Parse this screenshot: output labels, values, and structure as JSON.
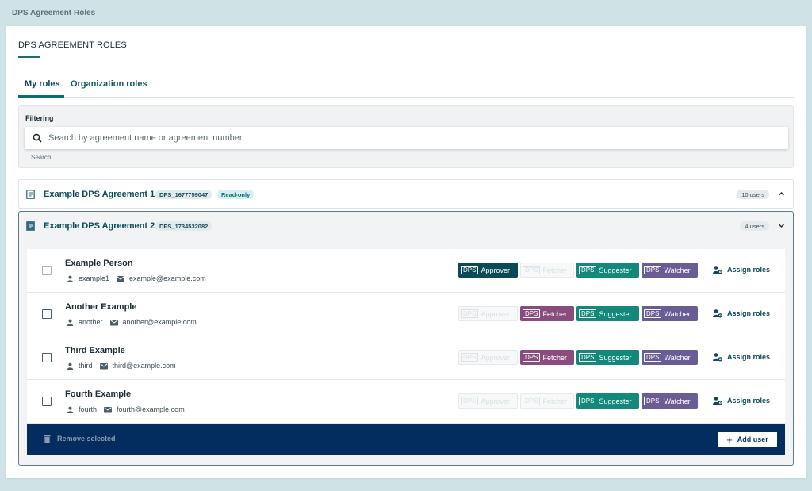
{
  "app": {
    "title": "DPS Agreement Roles"
  },
  "page": {
    "heading": "DPS AGREEMENT ROLES"
  },
  "tabs": [
    {
      "label": "My roles",
      "active": true
    },
    {
      "label": "Organization roles",
      "active": false
    }
  ],
  "filter": {
    "label": "Filtering",
    "search_placeholder": "Search by agreement name or agreement number",
    "search_helper": "Search"
  },
  "agreements": [
    {
      "name": "Example DPS Agreement 1",
      "number": "DPS_1677759047",
      "readonly_label": "Read-only",
      "users_count": "10 users",
      "expanded": false
    },
    {
      "name": "Example DPS Agreement 2",
      "number": "DPS_1734532082",
      "users_count": "4 users",
      "expanded": true
    }
  ],
  "role_prefix": "DPS",
  "role_labels": {
    "approver": "Approver",
    "fetcher": "Fetcher",
    "suggester": "Suggester",
    "watcher": "Watcher"
  },
  "assign_label": "Assign roles",
  "users": [
    {
      "name": "Example Person",
      "username": "example1",
      "email": "example@example.com",
      "roles": {
        "approver": true,
        "fetcher": false,
        "suggester": true,
        "watcher": true
      }
    },
    {
      "name": "Another Example",
      "username": "another",
      "email": "another@example.com",
      "roles": {
        "approver": false,
        "fetcher": true,
        "suggester": true,
        "watcher": true
      }
    },
    {
      "name": "Third Example",
      "username": "third",
      "email": "third@example.com",
      "roles": {
        "approver": false,
        "fetcher": true,
        "suggester": true,
        "watcher": true
      }
    },
    {
      "name": "Fourth Example",
      "username": "fourth",
      "email": "fourth@example.com",
      "roles": {
        "approver": false,
        "fetcher": false,
        "suggester": true,
        "watcher": true
      }
    }
  ],
  "footer": {
    "remove_label": "Remove selected",
    "add_label": "Add user"
  },
  "colors": {
    "approver": "#0a4a57",
    "fetcher": "#8a4c7d",
    "suggester": "#12897a",
    "watcher": "#6a5c95",
    "footer": "#032d5e",
    "accent": "#0f6b73"
  }
}
